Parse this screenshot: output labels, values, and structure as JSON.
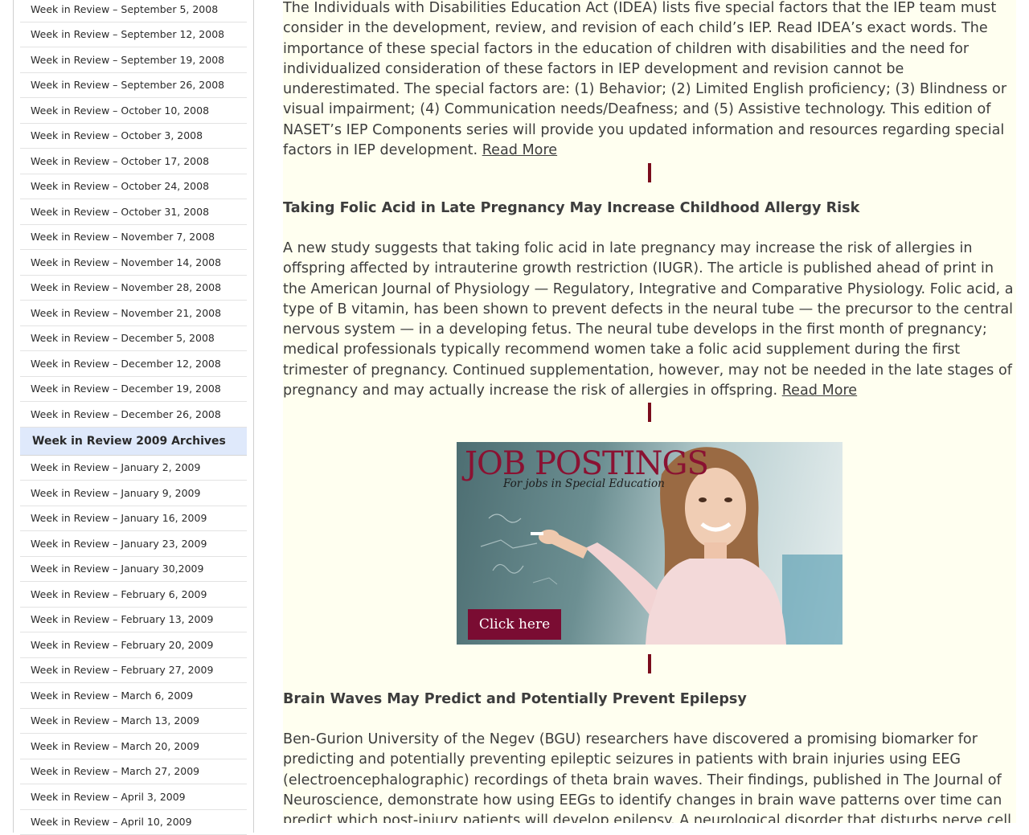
{
  "sidebar": {
    "items_2008": [
      "Week in Review – September 5, 2008",
      "Week in Review – September 12, 2008",
      "Week in Review – September 19, 2008",
      "Week in Review – September 26, 2008",
      "Week in Review – October 10, 2008",
      "Week in Review – October 3, 2008",
      "Week in Review – October 17, 2008",
      "Week in Review – October 24, 2008",
      "Week in Review – October 31, 2008",
      "Week in Review – November 7, 2008",
      "Week in Review – November 14, 2008",
      "Week in Review – November 28, 2008",
      "Week in Review – November 21, 2008",
      "Week in Review – December 5, 2008",
      "Week in Review – December 12, 2008",
      "Week in Review – December 19, 2008",
      "Week in Review – December 26, 2008"
    ],
    "header_2009": "Week in Review 2009 Archives",
    "items_2009": [
      "Week in Review – January 2, 2009",
      "Week in Review – January 9, 2009",
      "Week in Review – January 16, 2009",
      "Week in Review – January 23, 2009",
      "Week in Review – January 30,2009",
      "Week in Review – February 6, 2009",
      "Week in Review – February 13, 2009",
      "Week in Review – February 20, 2009",
      "Week in Review – February 27, 2009",
      "Week in Review – March 6, 2009",
      "Week in Review – March 13, 2009",
      "Week in Review – March 20, 2009",
      "Week in Review – March 27, 2009",
      "Week in Review – April 3, 2009",
      "Week in Review – April 10, 2009"
    ]
  },
  "main": {
    "article1": {
      "body": "The Individuals with Disabilities Education Act (IDEA) lists five special factors that the IEP team must consider in the development, review, and revision of each child’s IEP. Read IDEA’s exact words. The importance of these special factors in the education of children with disabilities and the need for individualized consideration of these factors in IEP development and revision cannot be underestimated. The special factors are: (1) Behavior; (2) Limited English proficiency; (3) Blindness or visual impairment; (4) Communication needs/Deafness; and (5) Assistive technology. This edition of NASET’s IEP Components series will provide you updated information and resources regarding special factors in IEP development.",
      "read_more": "Read More"
    },
    "article2": {
      "title": "Taking Folic Acid in Late Pregnancy May Increase Childhood Allergy Risk",
      "body": "A new study suggests that taking folic acid in late pregnancy may increase the risk of allergies in offspring affected by intrauterine growth restriction (IUGR). The article is published ahead of print in the American Journal of Physiology — Regulatory, Integrative and Comparative Physiology. Folic acid, a type of B vitamin, has been shown to prevent defects in the neural tube — the precursor to the central nervous system — in a developing fetus. The neural tube develops in the first month of pregnancy; medical professionals typically recommend women take a folic acid supplement during the first trimester of pregnancy. Continued supplementation, however, may not be needed in the late stages of pregnancy and may actually increase the risk of allergies in offspring.",
      "read_more": "Read More"
    },
    "ad": {
      "title": "JOB POSTINGS",
      "subtitle": "For jobs in Special Education",
      "button": "Click here"
    },
    "article3": {
      "title": "Brain Waves May Predict and Potentially Prevent Epilepsy",
      "body": "Ben-Gurion University of the Negev (BGU) researchers have discovered a promising biomarker for predicting and potentially preventing epileptic seizures in patients with brain injuries using EEG (electroencephalographic) recordings of theta brain waves. Their findings, published in The Journal of Neuroscience, demonstrate how using EEGs to identify changes in brain wave patterns over time can predict which post-injury patients will develop epilepsy. A neurological disorder that disturbs nerve cell"
    }
  },
  "colors": {
    "content_bg": "#fffff0",
    "separator": "#7a0c1c",
    "sidebar_header_bg": "#dfe9fb",
    "ad_accent": "#7a0c32"
  }
}
